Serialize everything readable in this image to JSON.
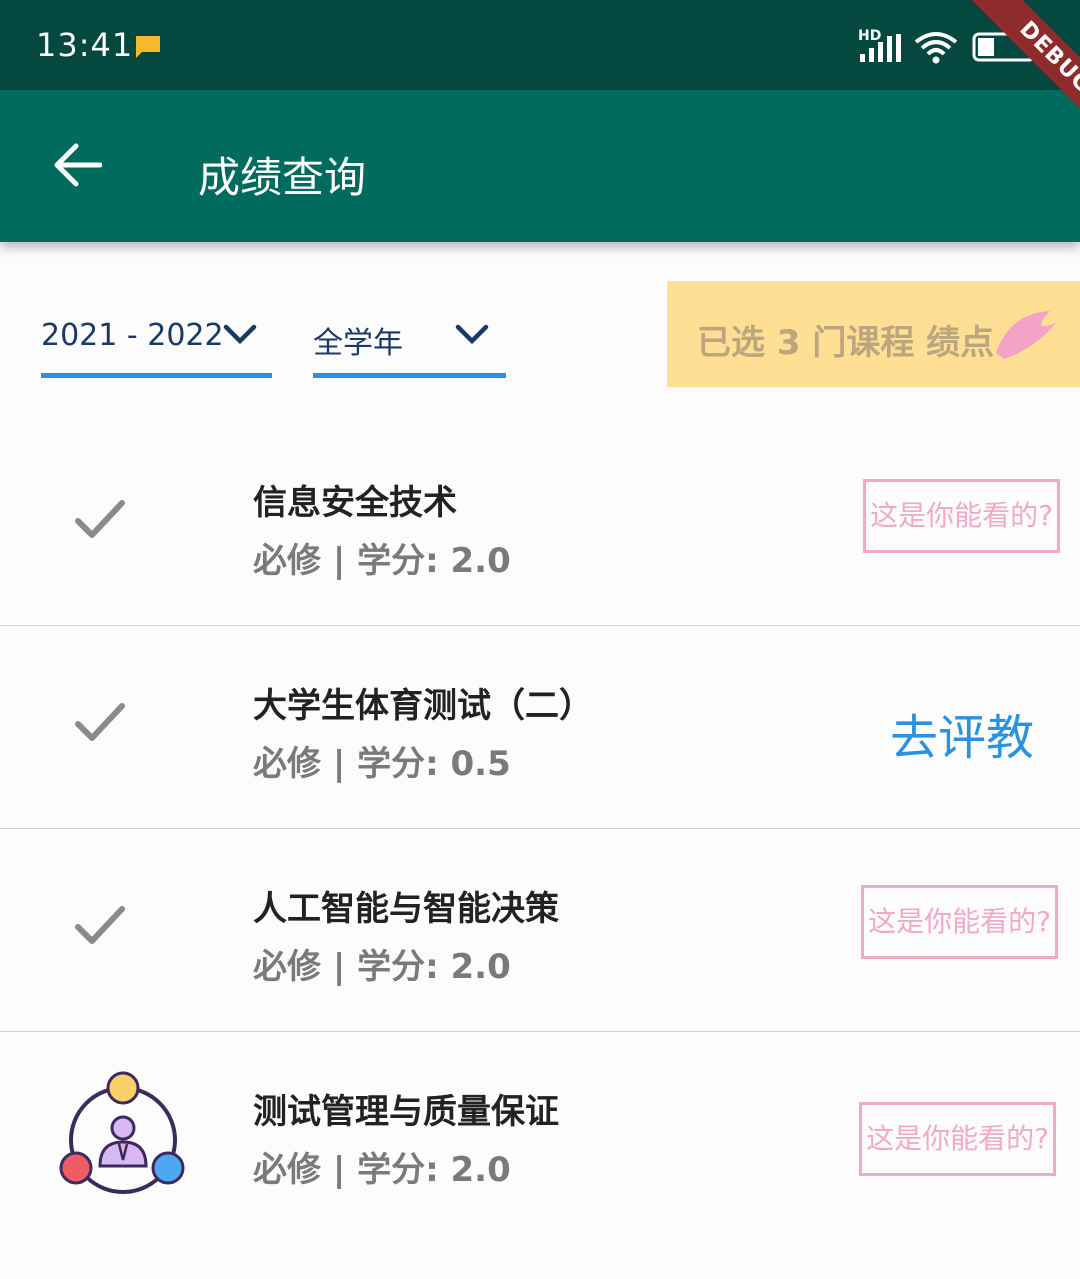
{
  "status_bar": {
    "time": "13:41",
    "network_label": "HD",
    "battery_level": "31"
  },
  "debug_banner": "DEBUG",
  "app_bar": {
    "title": "成绩查询"
  },
  "filters": {
    "year": "2021 - 2022",
    "term": "全学年"
  },
  "gpa": {
    "text": "已选 3 门课程 绩点"
  },
  "courses": [
    {
      "name": "信息安全技术",
      "type": "必修",
      "credit_label": "学分: 2.0",
      "action": "这是你能看的?",
      "icon": "checkmark-icon"
    },
    {
      "name": "大学生体育测试（二）",
      "type": "必修",
      "credit_label": "学分: 0.5",
      "action": "去评教",
      "icon": "checkmark-icon"
    },
    {
      "name": "人工智能与智能决策",
      "type": "必修",
      "credit_label": "学分: 2.0",
      "action": "这是你能看的?",
      "icon": "checkmark-icon"
    },
    {
      "name": "测试管理与质量保证",
      "type": "必修",
      "credit_label": "学分: 2.0",
      "action": "这是你能看的?",
      "icon": "team-person-icon"
    }
  ],
  "colors": {
    "status_bar": "#04483f",
    "app_bar": "#016b5e",
    "dropdown_underline": "#2490e8",
    "gpa_background": "#ffdf94",
    "hint_pink": "#f2a9c8",
    "link_blue": "#2a93e0"
  }
}
